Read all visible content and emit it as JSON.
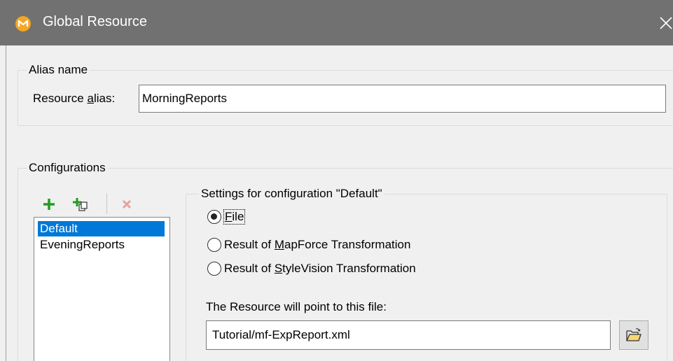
{
  "window": {
    "title": "Global Resource",
    "icons": {
      "app": "mapforce-logo-icon",
      "close": "close-icon"
    },
    "colors": {
      "titlebar": "#717171",
      "selection": "#0078d7",
      "accent_orange": "#f5a623"
    }
  },
  "alias": {
    "group_label": "Alias name",
    "field_label_pre": "Resource ",
    "field_label_u": "a",
    "field_label_post": "lias:",
    "value": "MorningReports"
  },
  "configurations": {
    "group_label": "Configurations",
    "toolbar": [
      {
        "name": "add-configuration",
        "icon": "plus-icon"
      },
      {
        "name": "copy-configuration",
        "icon": "plus-copy-icon"
      },
      {
        "name": "delete-configuration",
        "icon": "delete-x-icon"
      }
    ],
    "items": [
      "Default",
      "EveningReports"
    ],
    "selected": "Default"
  },
  "settings": {
    "group_label": "Settings for configuration \"Default\"",
    "options": [
      {
        "pre": "",
        "u": "F",
        "post": "ile",
        "checked": true
      },
      {
        "pre": "Result of ",
        "u": "M",
        "post": "apForce Transformation",
        "checked": false
      },
      {
        "pre": "Result of ",
        "u": "S",
        "post": "tyleVision Transformation",
        "checked": false
      }
    ],
    "file_label": "The Resource will point to this file:",
    "file_value": "Tutorial/mf-ExpReport.xml",
    "browse_icon": "open-folder-icon"
  }
}
